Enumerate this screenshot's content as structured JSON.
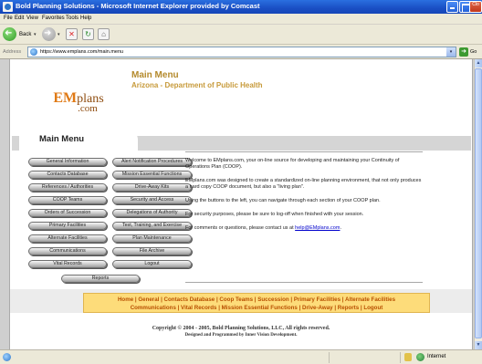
{
  "window": {
    "title": "Bold Planning Solutions - Microsoft Internet Explorer provided by Comcast",
    "close_label": "Clo"
  },
  "menubar": [
    "File",
    "Edit",
    "View",
    "Favorites",
    "Tools",
    "Help"
  ],
  "toolbar": {
    "back_label": "Back"
  },
  "address": {
    "label": "Address",
    "url": "https://www.emplans.com/main.menu",
    "go_label": "Go"
  },
  "header": {
    "logo_em": "EM",
    "logo_plans": "plans",
    "logo_com": ".com",
    "title": "Main Menu",
    "subtitle": "Arizona - Department of Public Health"
  },
  "menu_tab": "Main Menu",
  "left_buttons": [
    "General Information",
    "Contacts Database",
    "References / Authorities",
    "COOP Teams",
    "Orders of Succession",
    "Primary Facilities",
    "Alternate Facilities",
    "Communications",
    "Vital Records"
  ],
  "right_buttons": [
    "Alert Notification Procedures",
    "Mission Essential Functions",
    "Drive-Away Kits",
    "Security and Access",
    "Delegations of Authority",
    "Test, Training, and Exercise",
    "Plan Maintenance",
    "File Archive",
    "Logout"
  ],
  "reports_button": "Reports",
  "welcome": {
    "p1": "Welcome to EMplans.com, your on-line source for developing and maintaining your Continuity of Operations Plan (COOP).",
    "p2": "EMplans.com was designed to create a standardized on-line planning environment, that not only produces a hard copy COOP document, but also a \"living plan\".",
    "p3": "Using the buttons to the left, you can navigate through each section of your COOP plan.",
    "p4": "For security purposes, please be sure to log-off when finished with your session.",
    "p5_prefix": "For comments or questions, please contact us at ",
    "p5_link": "help@EMplans.com",
    "p5_suffix": "."
  },
  "footer_nav": {
    "line1": "Home | General | Contacts Database | Coop Teams | Succession | Primary Facilities | Alternate Facilities",
    "line2": "Communications | Vital Records | Mission Essential Functions | Drive-Away | Reports | Logout"
  },
  "copyright": {
    "line1": "Copyright © 2004 - 2005, Bold Planning Solutions, LLC, All rights reserved.",
    "line2": "Designed and Programmed by Inner Vision Development."
  },
  "status": {
    "zone": "Internet"
  },
  "icons": [
    "ie-icon",
    "back-arrow-icon",
    "forward-arrow-icon",
    "stop-icon",
    "refresh-icon",
    "home-icon",
    "page-icon",
    "go-arrow-icon",
    "lock-icon",
    "globe-icon"
  ]
}
